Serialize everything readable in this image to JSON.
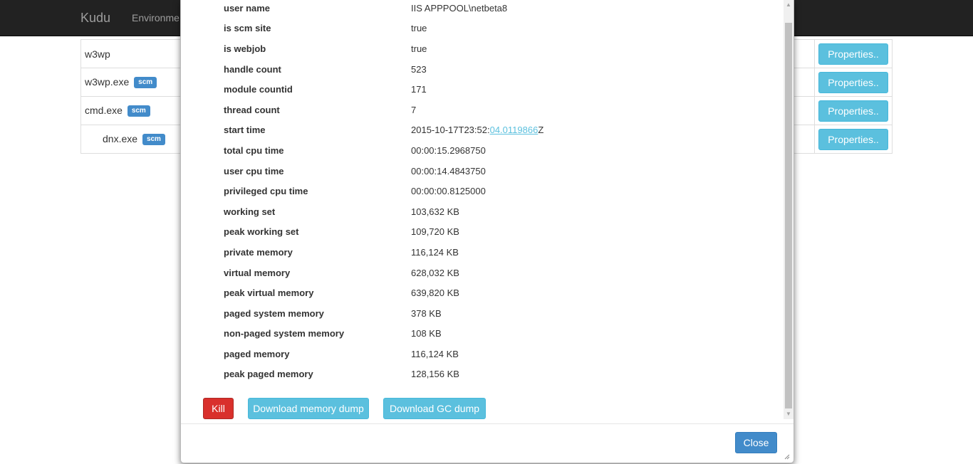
{
  "navbar": {
    "brand": "Kudu",
    "link": "Environme"
  },
  "processes": [
    {
      "name": "w3wp",
      "badge": "",
      "child": false,
      "action": "Properties.."
    },
    {
      "name": "w3wp.exe",
      "badge": "scm",
      "child": false,
      "action": "Properties.."
    },
    {
      "name": "cmd.exe",
      "badge": "scm",
      "child": false,
      "action": "Properties.."
    },
    {
      "name": "dnx.exe",
      "badge": "scm",
      "child": true,
      "action": "Properties.."
    }
  ],
  "properties": [
    {
      "key": "user name",
      "value": "IIS APPPOOL\\netbeta8"
    },
    {
      "key": "is scm site",
      "value": "true"
    },
    {
      "key": "is webjob",
      "value": "true"
    },
    {
      "key": "handle count",
      "value": "523"
    },
    {
      "key": "module countid",
      "value": "171"
    },
    {
      "key": "thread count",
      "value": "7"
    },
    {
      "key": "start time",
      "value_prefix": "2015-10-17T23:52:",
      "value_link": "04.0119866",
      "value_suffix": "Z"
    },
    {
      "key": "total cpu time",
      "value": "00:00:15.2968750"
    },
    {
      "key": "user cpu time",
      "value": "00:00:14.4843750"
    },
    {
      "key": "privileged cpu time",
      "value": "00:00:00.8125000"
    },
    {
      "key": "working set",
      "value": "103,632 KB"
    },
    {
      "key": "peak working set",
      "value": "109,720 KB"
    },
    {
      "key": "private memory",
      "value": "116,124 KB"
    },
    {
      "key": "virtual memory",
      "value": "628,032 KB"
    },
    {
      "key": "peak virtual memory",
      "value": "639,820 KB"
    },
    {
      "key": "paged system memory",
      "value": "378 KB"
    },
    {
      "key": "non-paged system memory",
      "value": "108 KB"
    },
    {
      "key": "paged memory",
      "value": "116,124 KB"
    },
    {
      "key": "peak paged memory",
      "value": "128,156 KB"
    }
  ],
  "actions": {
    "kill": "Kill",
    "download_memory_dump": "Download memory dump",
    "download_gc_dump": "Download GC dump"
  },
  "footer": {
    "close": "Close"
  }
}
